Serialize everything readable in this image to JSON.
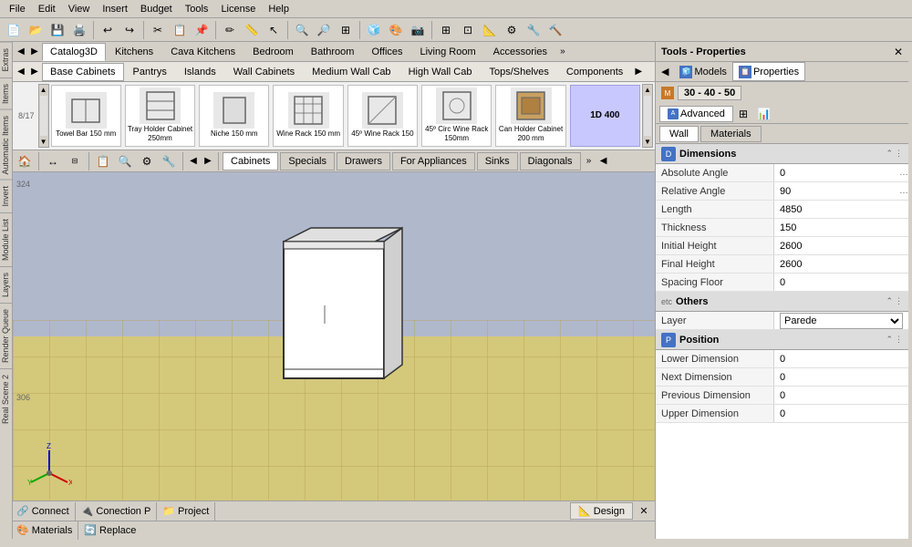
{
  "menubar": {
    "items": [
      "File",
      "Edit",
      "View",
      "Insert",
      "Budget",
      "Tools",
      "License",
      "Help"
    ]
  },
  "catalog": {
    "tabs1": [
      {
        "label": "Catalog3D",
        "active": true
      },
      {
        "label": "Kitchens"
      },
      {
        "label": "Cava Kitchens",
        "active": false
      },
      {
        "label": "Bedroom"
      },
      {
        "label": "Bathroom"
      },
      {
        "label": "Offices",
        "active": false
      },
      {
        "label": "Living Room"
      },
      {
        "label": "Accessories"
      }
    ],
    "tabs2": [
      {
        "label": "Base Cabinets",
        "active": true
      },
      {
        "label": "Pantrys"
      },
      {
        "label": "Islands"
      },
      {
        "label": "Wall Cabinets"
      },
      {
        "label": "Medium Wall Cab"
      },
      {
        "label": "High Wall Cab"
      },
      {
        "label": "Tops/Shelves"
      },
      {
        "label": "Components"
      }
    ],
    "item_count": "8/17",
    "items": [
      {
        "label": "Towel Bar 150 mm",
        "icon": "🪟"
      },
      {
        "label": "Tray Holder Cabinet 250mm",
        "icon": "🗄️"
      },
      {
        "label": "Niche 150 mm",
        "icon": "⬜"
      },
      {
        "label": "Wine Rack 150 mm",
        "icon": "🍷"
      },
      {
        "label": "45º Wine Rack 150",
        "icon": "🍾"
      },
      {
        "label": "45º Circ Wine Rack 150mm",
        "icon": "⭕"
      },
      {
        "label": "Can Holder Cabinet 200 mm",
        "icon": "🥫"
      },
      {
        "label": "1D 400",
        "special": true
      }
    ],
    "toolbar_items": [
      "Cabinets",
      "Specials",
      "Drawers",
      "For Appliances",
      "Sinks",
      "Diagonals"
    ]
  },
  "viewport": {
    "label_tl": "324",
    "label_bl": "306"
  },
  "right_panel": {
    "title": "Tools - Properties",
    "model_label": "30 - 40 - 50",
    "tabs_row1": [
      "Models",
      "Properties"
    ],
    "tabs_adv": [
      "Advanced"
    ],
    "wall_mat_tabs": [
      "Wall",
      "Materials"
    ],
    "sections": {
      "dimensions": {
        "title": "Dimensions",
        "fields": [
          {
            "label": "Absolute Angle",
            "value": "0"
          },
          {
            "label": "Relative Angle",
            "value": "90"
          },
          {
            "label": "Length",
            "value": "4850"
          },
          {
            "label": "Thickness",
            "value": "150"
          },
          {
            "label": "Initial Height",
            "value": "2600"
          },
          {
            "label": "Final Height",
            "value": "2600"
          },
          {
            "label": "Spacing Floor",
            "value": "0"
          }
        ]
      },
      "others": {
        "title": "Others",
        "fields": [
          {
            "label": "Layer",
            "value": "Parede",
            "type": "select"
          }
        ]
      },
      "position": {
        "title": "Position",
        "fields": [
          {
            "label": "Lower Dimension",
            "value": "0"
          },
          {
            "label": "Next Dimension",
            "value": "0"
          },
          {
            "label": "Previous Dimension",
            "value": "0"
          },
          {
            "label": "Upper Dimension",
            "value": "0"
          }
        ]
      }
    }
  },
  "statusbar": {
    "items": [
      "Connect",
      "Conection P",
      "Project",
      "Design",
      "Materials",
      "Replace"
    ]
  },
  "extras_tabs": [
    "Extras",
    "Items",
    "Automatic Items",
    "Invert",
    "Module List",
    "Layers",
    "Render Queue",
    "Real Scene 2"
  ]
}
